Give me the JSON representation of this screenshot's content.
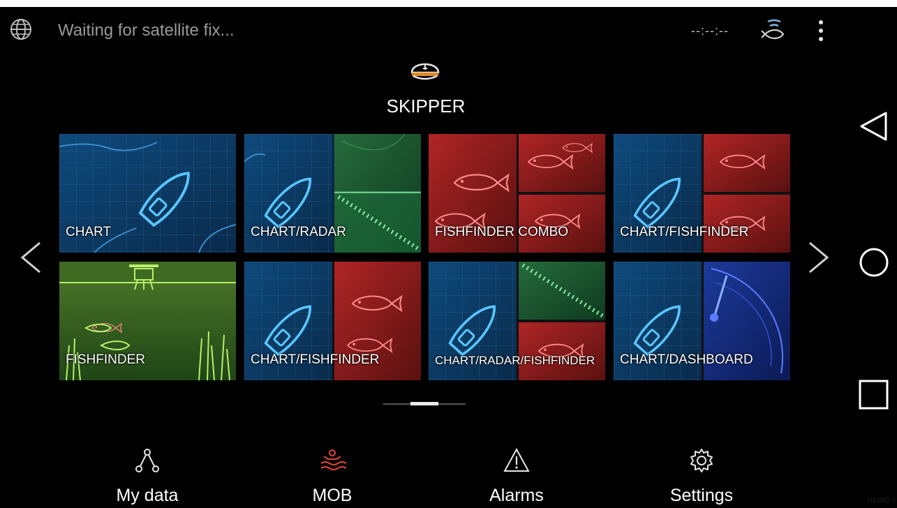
{
  "status_bar": {
    "gps_status": "Waiting for satellite fix...",
    "time": "--:--:--",
    "icons": [
      "globe-icon",
      "sonar-fish-icon",
      "more-vert-icon"
    ]
  },
  "profile": {
    "name": "SKIPPER",
    "icon": "captain-hat-icon"
  },
  "tiles": [
    {
      "label": "CHART"
    },
    {
      "label": "CHART/RADAR"
    },
    {
      "label": "FISHFINDER COMBO"
    },
    {
      "label": "CHART/FISHFINDER"
    },
    {
      "label": "FISHFINDER"
    },
    {
      "label": "CHART/FISHFINDER"
    },
    {
      "label": "CHART/RADAR/FISHFINDER"
    },
    {
      "label": "CHART/DASHBOARD"
    }
  ],
  "pager": {
    "current_page": 2,
    "page_count": 3
  },
  "bottom_bar": [
    {
      "label": "My data",
      "icon": "route-icon"
    },
    {
      "label": "MOB",
      "icon": "man-overboard-icon"
    },
    {
      "label": "Alarms",
      "icon": "warning-icon"
    },
    {
      "label": "Settings",
      "icon": "gear-icon"
    }
  ],
  "android_nav": [
    "back-icon",
    "home-icon",
    "recents-icon"
  ],
  "colors": {
    "background": "#000000",
    "chart_blue": "#0b3d66",
    "radar_green": "#1f6b3a",
    "fish_red": "#8a1b1b",
    "mob_red": "#e0453a",
    "dashboard_blue": "#12246b"
  },
  "document_id": "D13862-1"
}
